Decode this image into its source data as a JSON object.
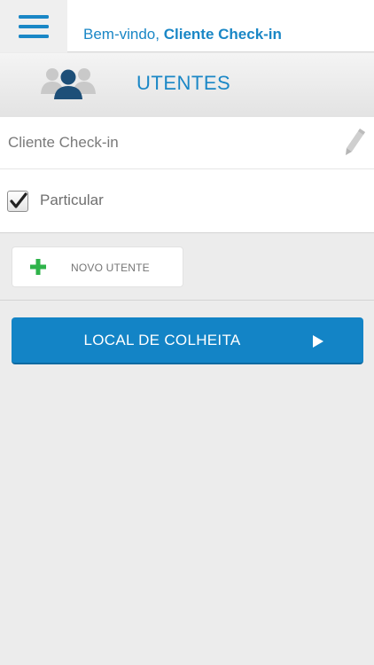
{
  "header": {
    "welcome_prefix": "Bem-vindo,",
    "welcome_name": "Cliente Check-in",
    "menu_icon": "hamburger-menu-icon"
  },
  "section": {
    "title": "UTENTES",
    "icon": "users-group-icon"
  },
  "client": {
    "name": "Cliente Check-in",
    "edit_icon": "pencil-icon"
  },
  "checkbox": {
    "label": "Particular",
    "checked": true
  },
  "new_patient_button": {
    "label": "NOVO UTENTE",
    "icon": "plus-icon"
  },
  "primary_button": {
    "label": "LOCAL DE COLHEITA",
    "icon": "play-arrow-icon"
  },
  "colors": {
    "accent": "#1a87c6",
    "primary_button": "#1384c6",
    "plus_green": "#2eb34a",
    "background": "#ececec"
  }
}
